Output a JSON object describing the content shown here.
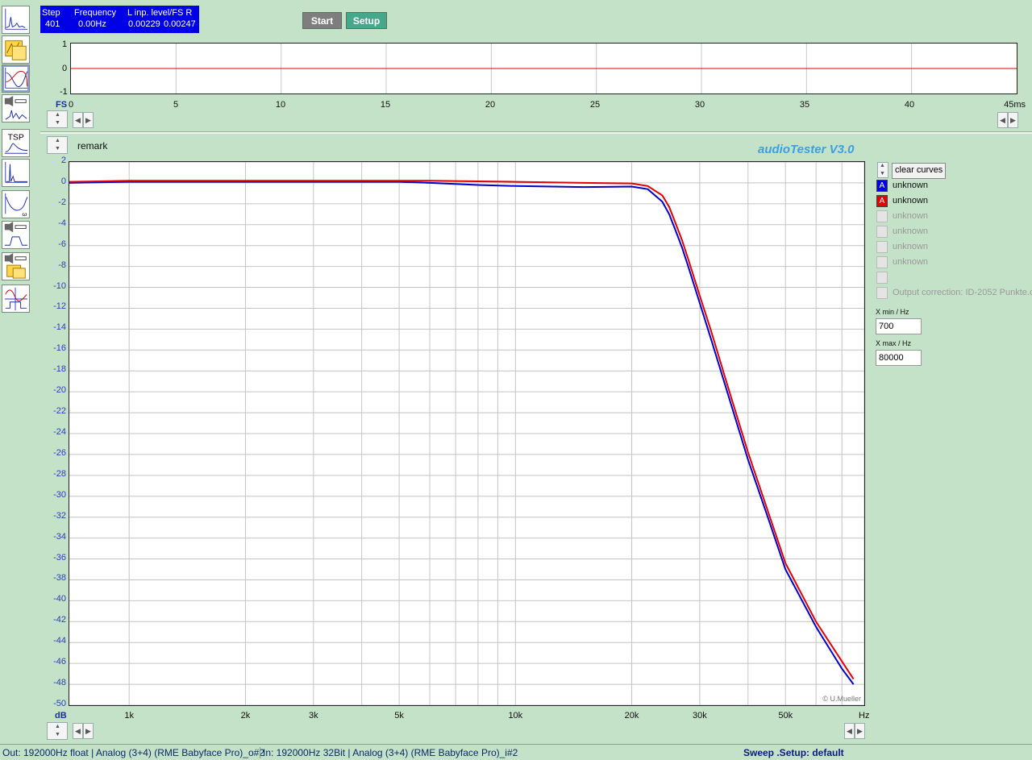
{
  "status": {
    "step_header": "Step",
    "step_value": "401",
    "freq_header": "Frequency",
    "freq_value": "0.00Hz",
    "level_header": "L  inp. level/FS  R",
    "level_l": "0.00229",
    "level_r": "0.00247"
  },
  "buttons": {
    "start": "Start",
    "setup": "Setup"
  },
  "toolbar": {
    "tools": [
      "spectrum-icon",
      "oscilloscope-icon",
      "frequency-response-icon",
      "distortion-icon",
      "tsp-icon",
      "impulse-icon",
      "impedance-icon",
      "filter-response-icon",
      "speaker-measure-icon",
      "step-response-icon"
    ],
    "tsp_label": "TSP"
  },
  "scope": {
    "y_ticks": [
      "1",
      "0",
      "-1"
    ],
    "y_unit": "FS",
    "x_ticks": [
      "0",
      "5",
      "10",
      "15",
      "20",
      "25",
      "30",
      "35",
      "40",
      "45ms"
    ]
  },
  "main": {
    "remark": "remark",
    "app_title": "audioTester  V3.0",
    "copyright": "© U.Mueller",
    "y_unit": "dB",
    "x_unit": "Hz",
    "x_tick_labels": [
      "1k",
      "2k",
      "3k",
      "5k",
      "10k",
      "20k",
      "30k",
      "50k"
    ]
  },
  "legend": {
    "clear_label": "clear curves",
    "entries": [
      {
        "letter": "A",
        "name": "unknown",
        "color": "#0000e0",
        "active": true
      },
      {
        "letter": "A",
        "name": "unknown",
        "color": "#e00000",
        "active": true
      },
      {
        "letter": "",
        "name": "unknown",
        "color": "",
        "active": false
      },
      {
        "letter": "",
        "name": "unknown",
        "color": "",
        "active": false
      },
      {
        "letter": "",
        "name": "unknown",
        "color": "",
        "active": false
      },
      {
        "letter": "",
        "name": "unknown",
        "color": "",
        "active": false
      },
      {
        "letter": "",
        "name": "",
        "color": "",
        "active": false
      }
    ],
    "output_correction": "Output correction: ID-2052 Punkte.c"
  },
  "range": {
    "xmin_label": "X min / Hz",
    "xmin_value": "700",
    "xmax_label": "X max / Hz",
    "xmax_value": "80000"
  },
  "statusbar": {
    "out": "Out: 192000Hz float  | Analog (3+4) (RME Babyface Pro)_o#2",
    "in": "In: 192000Hz 32Bit  | Analog (3+4) (RME Babyface Pro)_i#2",
    "sweep": "Sweep .Setup:  default"
  },
  "chart_data": {
    "type": "line",
    "xlabel": "Hz",
    "ylabel": "dB",
    "xscale": "log",
    "xlim": [
      700,
      80000
    ],
    "ylim": [
      -50,
      2
    ],
    "y_ticks": [
      2,
      0,
      -2,
      -4,
      -6,
      -8,
      -10,
      -12,
      -14,
      -16,
      -18,
      -20,
      -22,
      -24,
      -26,
      -28,
      -30,
      -32,
      -34,
      -36,
      -38,
      -40,
      -42,
      -44,
      -46,
      -48,
      -50
    ],
    "x_tick_labels": [
      "1k",
      "2k",
      "3k",
      "5k",
      "10k",
      "20k",
      "30k",
      "50k"
    ],
    "grid": true,
    "series": [
      {
        "color": "#0000c8",
        "x": [
          700,
          1000,
          2000,
          3000,
          5000,
          6000,
          8000,
          10000,
          15000,
          20000,
          22000,
          24000,
          25000,
          26000,
          27000,
          28000,
          30000,
          32000,
          35000,
          40000,
          45000,
          50000,
          60000,
          70000,
          75000
        ],
        "y": [
          0,
          0.1,
          0.1,
          0.1,
          0.1,
          0,
          -0.2,
          -0.3,
          -0.4,
          -0.35,
          -0.6,
          -1.8,
          -3,
          -4.6,
          -6.2,
          -8,
          -11.5,
          -14.8,
          -19.5,
          -26.5,
          -32,
          -37,
          -42.5,
          -46.5,
          -48
        ]
      },
      {
        "color": "#e00000",
        "x": [
          700,
          1000,
          2000,
          3000,
          5000,
          6000,
          8000,
          10000,
          15000,
          20000,
          22000,
          24000,
          25000,
          26000,
          27000,
          28000,
          30000,
          32000,
          35000,
          40000,
          45000,
          50000,
          60000,
          70000,
          75000
        ],
        "y": [
          0.1,
          0.2,
          0.2,
          0.2,
          0.2,
          0.2,
          0.15,
          0.1,
          0,
          -0.05,
          -0.3,
          -1.2,
          -2.3,
          -3.9,
          -5.5,
          -7.3,
          -10.8,
          -14,
          -18.8,
          -25.8,
          -31.4,
          -36.4,
          -42,
          -45.8,
          -47.5
        ]
      }
    ]
  }
}
